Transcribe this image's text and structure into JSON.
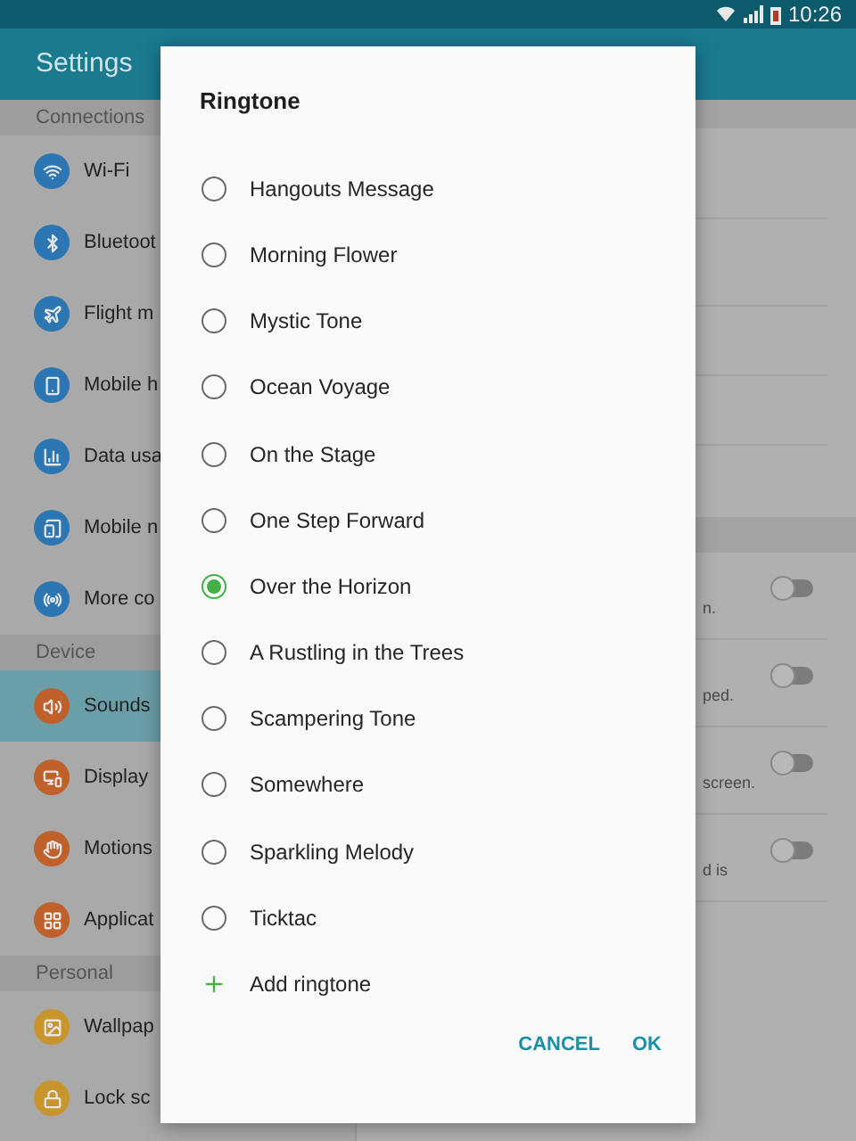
{
  "status_bar": {
    "time": "10:26"
  },
  "header": {
    "title": "Settings"
  },
  "sidebar": {
    "sections": [
      {
        "title": "Connections",
        "items": [
          {
            "label": "Wi-Fi",
            "selected": false,
            "color": "#2c77b3"
          },
          {
            "label": "Bluetoot",
            "selected": false,
            "color": "#2c77b3"
          },
          {
            "label": "Flight m",
            "selected": false,
            "color": "#2c77b3"
          },
          {
            "label": "Mobile h",
            "selected": false,
            "color": "#2c77b3"
          },
          {
            "label": "Data usa",
            "selected": false,
            "color": "#2c77b3"
          },
          {
            "label": "Mobile n",
            "selected": false,
            "color": "#2c77b3"
          },
          {
            "label": "More co",
            "selected": false,
            "color": "#2c77b3"
          }
        ]
      },
      {
        "title": "Device",
        "items": [
          {
            "label": "Sounds",
            "selected": true,
            "color": "#c0602a"
          },
          {
            "label": "Display",
            "selected": false,
            "color": "#c0602a"
          },
          {
            "label": "Motions",
            "selected": false,
            "color": "#c0602a"
          },
          {
            "label": "Applicat",
            "selected": false,
            "color": "#c0602a"
          }
        ]
      },
      {
        "title": "Personal",
        "items": [
          {
            "label": "Wallpap",
            "selected": false,
            "color": "#c8952c"
          },
          {
            "label": "Lock sc",
            "selected": false,
            "color": "#c8952c"
          }
        ]
      }
    ]
  },
  "detail": {
    "toggles": [
      {
        "text": "n.",
        "on": false
      },
      {
        "text": "ped.",
        "on": false
      },
      {
        "text": "screen.",
        "on": false
      },
      {
        "text": "d is",
        "on": false
      }
    ]
  },
  "dialog": {
    "title": "Ringtone",
    "options": [
      {
        "label": "Hangouts Message",
        "selected": false
      },
      {
        "label": "Morning Flower",
        "selected": false
      },
      {
        "label": "Mystic Tone",
        "selected": false
      },
      {
        "label": "Ocean Voyage",
        "selected": false
      },
      {
        "label": "On the Stage",
        "selected": false
      },
      {
        "label": "One Step Forward",
        "selected": false
      },
      {
        "label": "Over the Horizon",
        "selected": true
      },
      {
        "label": "A Rustling in the Trees",
        "selected": false
      },
      {
        "label": "Scampering Tone",
        "selected": false
      },
      {
        "label": "Somewhere",
        "selected": false
      },
      {
        "label": "Sparkling Melody",
        "selected": false
      },
      {
        "label": "Ticktac",
        "selected": false
      }
    ],
    "add_label": "Add ringtone",
    "buttons": [
      "CANCEL",
      "OK"
    ]
  }
}
